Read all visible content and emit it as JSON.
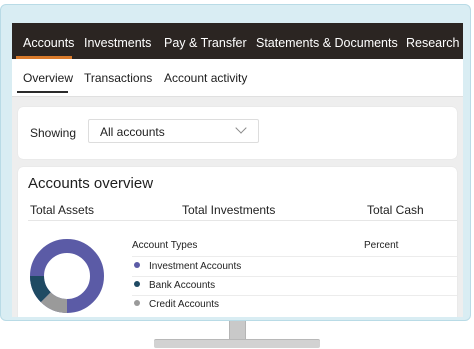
{
  "topnav": {
    "items": [
      "Accounts",
      "Investments",
      "Pay & Transfer",
      "Statements & Documents",
      "Research &"
    ],
    "active": "Accounts"
  },
  "subnav": {
    "items": [
      "Overview",
      "Transactions",
      "Account activity"
    ],
    "active": "Overview"
  },
  "showing": {
    "label": "Showing",
    "selected": "All accounts"
  },
  "overview": {
    "title": "Accounts overview",
    "headers": [
      "Total Assets",
      "Total Investments",
      "Total Cash"
    ],
    "table": {
      "col_types": "Account Types",
      "col_percent": "Percent",
      "rows": [
        {
          "label": "Investment Accounts",
          "color": "#5b5ba6"
        },
        {
          "label": "Bank Accounts",
          "color": "#1f4a63"
        },
        {
          "label": "Credit Accounts",
          "color": "#9a9a9a"
        }
      ]
    }
  },
  "colors": {
    "nav_bg": "#2b2522",
    "nav_accent": "#d97a2b",
    "investment": "#5b5ba6",
    "bank": "#1f4a63",
    "credit": "#9a9a9a"
  }
}
